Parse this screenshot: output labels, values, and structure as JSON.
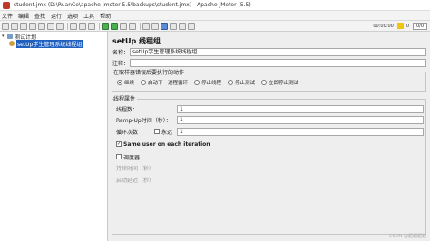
{
  "window": {
    "title": "student.jmx (D:\\RuanCe\\apache-jmeter-5.5\\backups\\student.jmx) - Apache JMeter (5.5)"
  },
  "menu": {
    "items": [
      "文件",
      "编辑",
      "查找",
      "运行",
      "选项",
      "工具",
      "帮助"
    ]
  },
  "toolbar": {
    "elapsed": "00:00:00",
    "warnings": "0",
    "threads": "0/0"
  },
  "tree": {
    "test_plan": "测试计划",
    "setup_group_prefix": "setUp",
    "setup_group_name": "学生管理系统线程组"
  },
  "panel": {
    "title": "setUp 线程组",
    "name_label": "名称：",
    "name_value": "setUp学生管理系统线程组",
    "comment_label": "注释：",
    "comment_value": "",
    "error_group_title": "在取样器错误后要执行的动作",
    "error_actions": [
      {
        "label": "继续",
        "checked": true
      },
      {
        "label": "启动下一进程循环",
        "checked": false
      },
      {
        "label": "停止线程",
        "checked": false
      },
      {
        "label": "停止测试",
        "checked": false
      },
      {
        "label": "立即停止测试",
        "checked": false
      }
    ],
    "thread_props_title": "线程属性",
    "threads_label": "线程数：",
    "threads_value": "1",
    "rampup_label": "Ramp-Up时间（秒）：",
    "rampup_value": "1",
    "loop_label": "循环次数",
    "loop_forever_label": "永远",
    "loop_forever_checked": false,
    "loop_value": "1",
    "same_user_label": "Same user on each iteration",
    "same_user_checked": true,
    "scheduler_label": "调度器",
    "scheduler_checked": false,
    "duration_label": "持续时间（秒）",
    "startup_delay_label": "启动延迟（秒）"
  },
  "watermark": "CSDN @超越超越"
}
